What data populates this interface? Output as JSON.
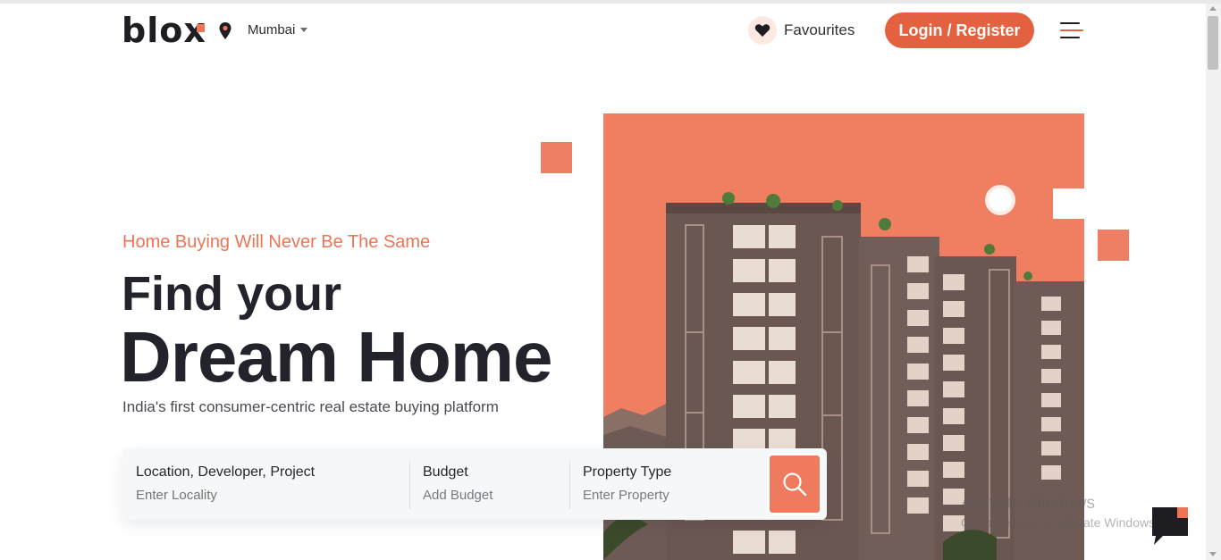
{
  "header": {
    "logo_text": "blox",
    "location": "Mumbai",
    "favourites_label": "Favourites",
    "login_label": "Login / Register"
  },
  "hero": {
    "tagline": "Home Buying Will Never Be The Same",
    "headline_line1": "Find your",
    "headline_line2": "Dream Home",
    "subtext": "India's first consumer-centric real estate buying platform"
  },
  "search": {
    "location_label": "Location, Developer, Project",
    "location_placeholder": "Enter Locality",
    "budget_label": "Budget",
    "budget_value": "Add Budget",
    "property_label": "Property Type",
    "property_value": "Enter Property"
  },
  "watermark": {
    "line1": "Activate Windows",
    "line2": "Go to Settings to activate Windows."
  },
  "colors": {
    "accent": "#ee7456",
    "button": "#e4613f",
    "hero_bg": "#f07f62",
    "text_dark": "#23242b"
  },
  "icons": {
    "location": "map-pin-icon",
    "favourites": "heart-icon",
    "menu": "hamburger-menu-icon",
    "search": "search-icon",
    "chat": "chat-bubble-icon"
  }
}
